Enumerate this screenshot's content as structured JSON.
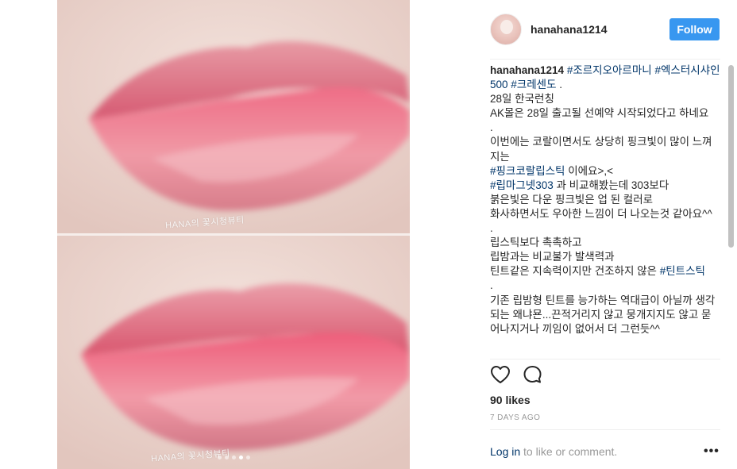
{
  "post": {
    "username": "hanahana1214",
    "follow_label": "Follow",
    "likes": "90 likes",
    "timestamp": "7 DAYS AGO",
    "login_link": "Log in",
    "login_suffix": " to like or comment.",
    "more": "•••"
  },
  "photo": {
    "watermark": "HANA의 꽃시청뷰티",
    "carousel_count": 5,
    "carousel_active": 4
  },
  "caption": {
    "line1": [
      {
        "text": "hanahana1214",
        "type": "user"
      },
      {
        "text": " ",
        "type": "text"
      },
      {
        "text": "#조르지오아르마니",
        "type": "tag"
      },
      {
        "text": " ",
        "type": "text"
      },
      {
        "text": "#엑스터시샤인500",
        "type": "tag"
      },
      {
        "text": " ",
        "type": "text"
      },
      {
        "text": "#크레센도",
        "type": "tag"
      },
      {
        "text": " .",
        "type": "text"
      }
    ],
    "lines": [
      [
        {
          "text": "28일 한국런칭",
          "type": "text"
        }
      ],
      [
        {
          "text": "AK몰은 28일 출고될 선예약 시작되었다고 하네요",
          "type": "text"
        }
      ],
      [
        {
          "text": ".",
          "type": "text"
        }
      ],
      [
        {
          "text": "이번에는 코랄이면서도 상당히 핑크빛이 많이 느껴지는",
          "type": "text"
        }
      ],
      [
        {
          "text": "#핑크코랄립스틱",
          "type": "tag"
        },
        {
          "text": " 이에요>,<",
          "type": "text"
        }
      ],
      [
        {
          "text": "#립마그넷303",
          "type": "tag"
        },
        {
          "text": " 과 비교해봤는데 303보다",
          "type": "text"
        }
      ],
      [
        {
          "text": "붉은빛은 다운 핑크빛은 업 된 컬러로",
          "type": "text"
        }
      ],
      [
        {
          "text": "화사하면서도 우아한 느낌이 더 나오는것 같아요^^",
          "type": "text"
        }
      ],
      [
        {
          "text": ".",
          "type": "text"
        }
      ],
      [
        {
          "text": "립스틱보다 촉촉하고",
          "type": "text"
        }
      ],
      [
        {
          "text": "립밤과는 비교불가 발색력과",
          "type": "text"
        }
      ],
      [
        {
          "text": "틴트같은 지속력이지만 건조하지 않은 ",
          "type": "text"
        },
        {
          "text": "#틴트스틱",
          "type": "tag"
        }
      ],
      [
        {
          "text": ".",
          "type": "text"
        }
      ],
      [
        {
          "text": "기존 립밤형 틴트를 능가하는 역대급이 아닐까 생각되는 왜냐묜...끈적거리지 않고 뭉개지지도 않고 묻어나지거나 끼임이 없어서 더 그런듯^^",
          "type": "text"
        }
      ]
    ]
  },
  "colors": {
    "accent": "#3897f0",
    "hashtag": "#003569",
    "muted": "#999999",
    "divider": "#efefef"
  },
  "icons": [
    "heart-icon",
    "comment-icon",
    "more-options-icon"
  ]
}
